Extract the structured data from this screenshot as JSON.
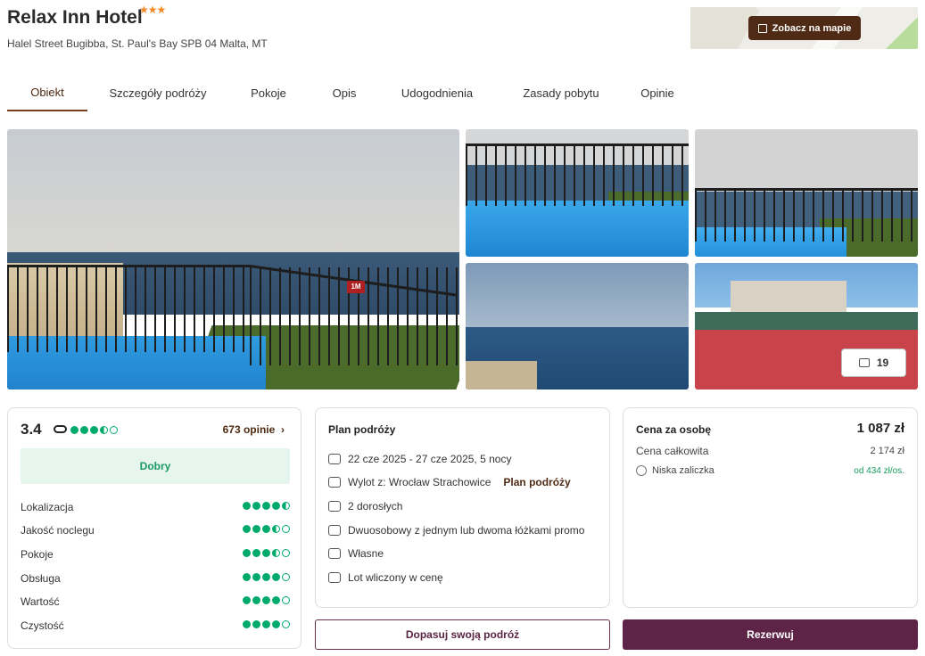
{
  "hotel": {
    "name": "Relax Inn Hotel",
    "stars": "★★★",
    "address": "Halel Street Bugibba, St. Paul's Bay SPB 04 Malta, MT"
  },
  "map": {
    "button_label": "Zobacz na mapie",
    "icon": "map-icon"
  },
  "tabs": [
    {
      "label": "Obiekt",
      "active": true
    },
    {
      "label": "Szczegóły podróży"
    },
    {
      "label": "Pokoje"
    },
    {
      "label": "Opis"
    },
    {
      "label": "Udogodnienia"
    },
    {
      "label": "Zasady pobytu"
    },
    {
      "label": "Opinie"
    }
  ],
  "gallery": {
    "photo_count": "19",
    "icon": "gallery-icon"
  },
  "rating": {
    "score": "3.4",
    "score_dots": 3.5,
    "reviews": "673 opinie",
    "verdict": "Dobry",
    "categories": [
      {
        "label": "Lokalizacja",
        "value": 4.5
      },
      {
        "label": "Jakość noclegu",
        "value": 3.5
      },
      {
        "label": "Pokoje",
        "value": 3.5
      },
      {
        "label": "Obsługa",
        "value": 4
      },
      {
        "label": "Wartość",
        "value": 4
      },
      {
        "label": "Czystość",
        "value": 4
      }
    ]
  },
  "plan": {
    "title": "Plan podróży",
    "dates": "22 cze 2025 - 27 cze 2025, 5 nocy",
    "flight": "Wylot z: Wrocław Strachowice",
    "flight_link": "Plan podróży",
    "guests": "2 dorosłych",
    "room": "Dwuosobowy z jednym lub dwoma łóżkami promo",
    "board": "Własne",
    "transport": "Lot wliczony w cenę"
  },
  "price": {
    "per_person_label": "Cena za osobę",
    "per_person_value": "1 087 zł",
    "total_label": "Cena całkowita",
    "total_value": "2 174 zł",
    "deposit_label": "Niska zaliczka",
    "deposit_value": "od 434 zł/os."
  },
  "buttons": {
    "customize": "Dopasuj swoją podróż",
    "book": "Rezerwuj"
  },
  "colors": {
    "brand_brown": "#4f2a14",
    "brand_plum": "#5e2447",
    "rating_green": "#00aa6c"
  }
}
